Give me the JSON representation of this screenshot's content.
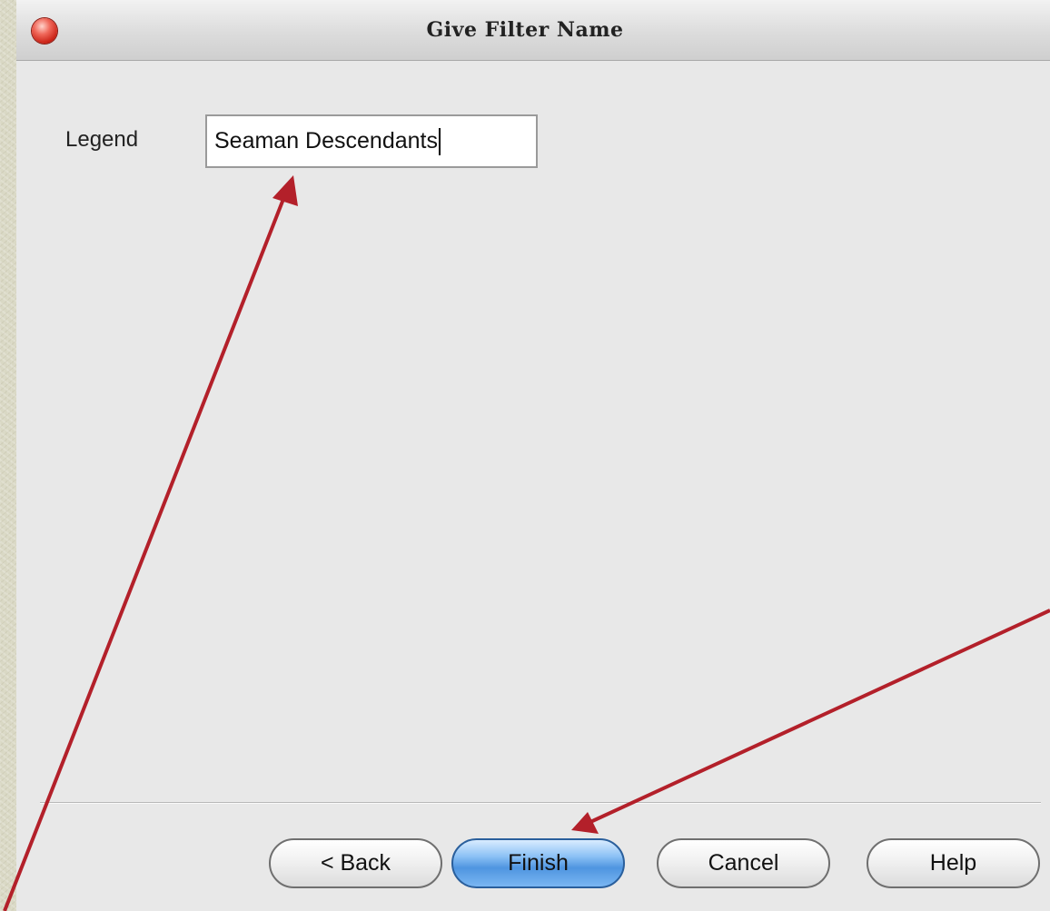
{
  "window": {
    "title": "Give Filter Name"
  },
  "form": {
    "legend_label": "Legend",
    "legend_value": "Seaman Descendants"
  },
  "buttons": {
    "back": "< Back",
    "finish": "Finish",
    "cancel": "Cancel",
    "help": "Help"
  },
  "colors": {
    "annotation_arrow": "#b3202a",
    "finish_button": "#5a9ee6",
    "close_button": "#d9372a"
  },
  "icons": {
    "close": "close-icon",
    "annotation": "arrow-icon"
  }
}
